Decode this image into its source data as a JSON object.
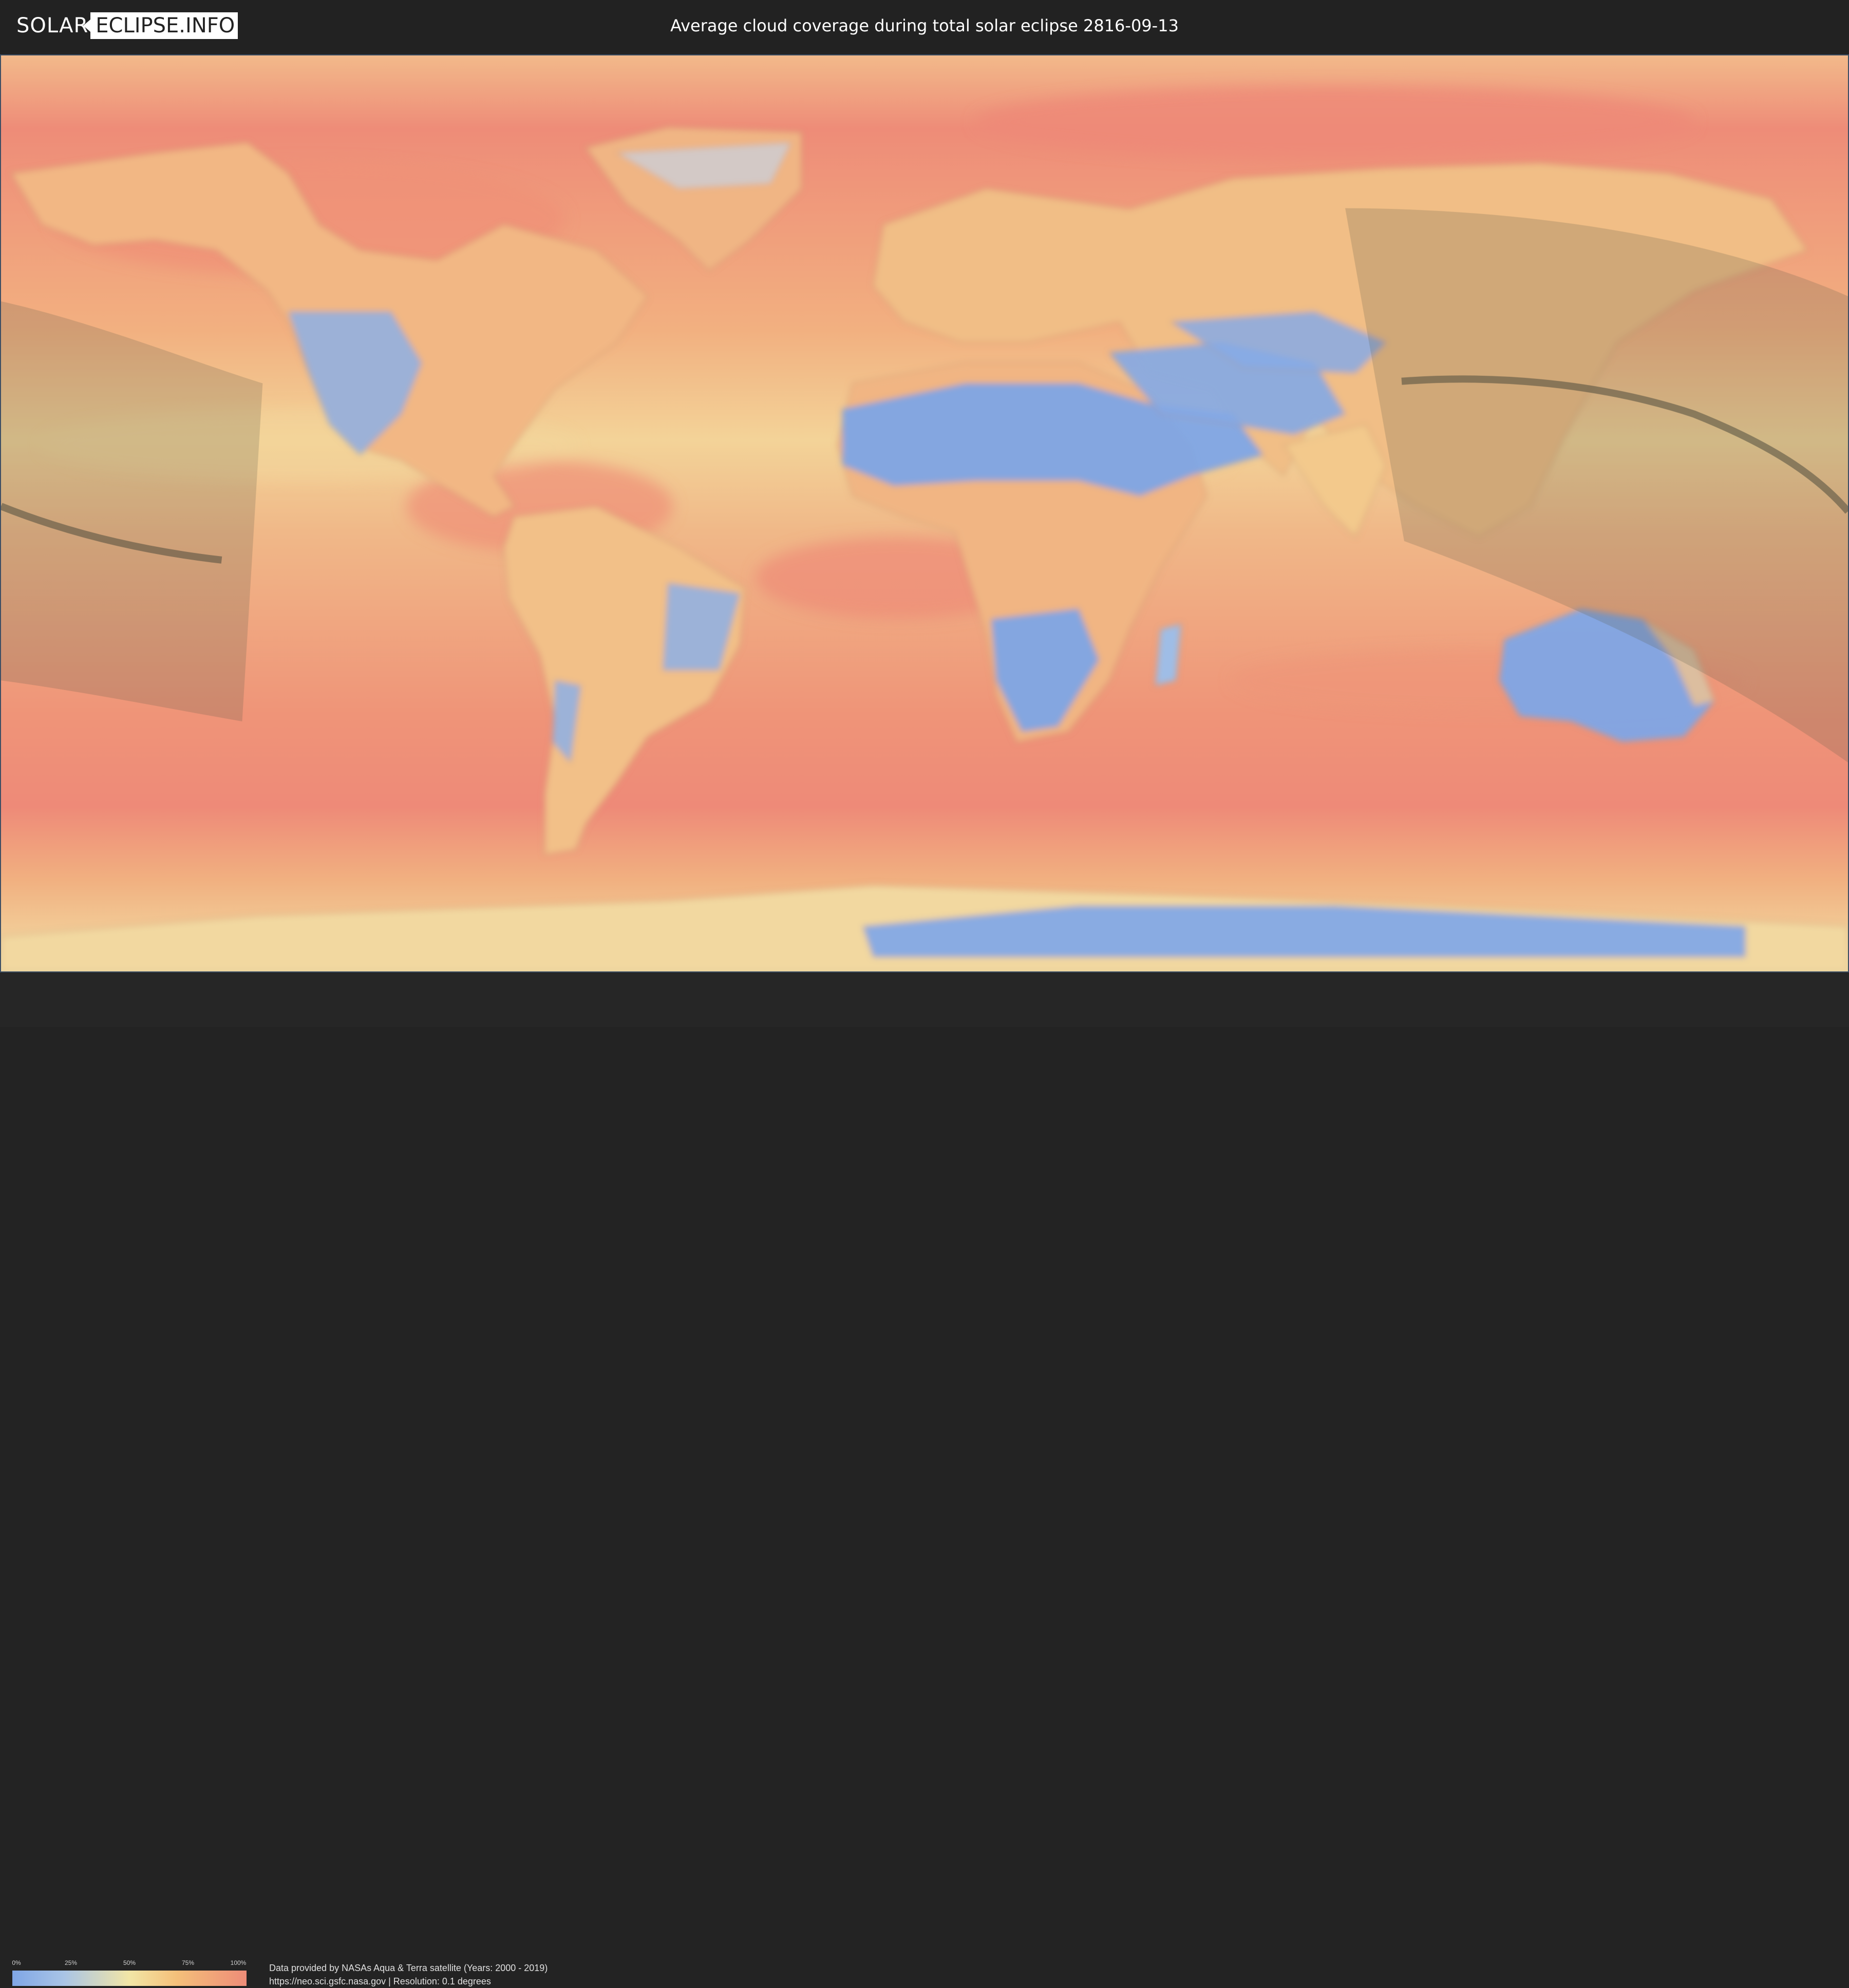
{
  "header": {
    "logo_solar": "SOLAR",
    "logo_eclipse": "ECLIPSE.INFO",
    "title": "Average cloud coverage during total solar eclipse 2816-09-13"
  },
  "map": {
    "colors": {
      "low_cloud": "#7fa6e6",
      "mid_cloud": "#f2e6a6",
      "high_cloud": "#ee8c78",
      "ocean_base": "#f0a070",
      "eclipse_band": "#6f6a5a"
    }
  },
  "legend": {
    "ticks": [
      "0%",
      "25%",
      "50%",
      "75%",
      "100%"
    ]
  },
  "credits": {
    "line1": "Data provided by NASAs Aqua & Terra satellite (Years: 2000 - 2019)",
    "line2": "https://neo.sci.gsfc.nasa.gov | Resolution: 0.1 degrees"
  }
}
